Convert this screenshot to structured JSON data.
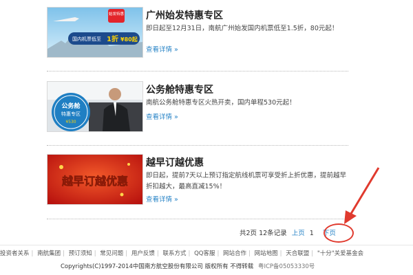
{
  "promos": [
    {
      "title": "广州始发特惠专区",
      "desc": "即日起至12月31日，南航广州始发国内机票低至1.5折，80元起！",
      "more": "查看详情 »",
      "banner": {
        "badge": "始发特惠",
        "line1": "国内机票低至",
        "price": "1折",
        "price2": "¥80起"
      }
    },
    {
      "title": "公务舱特惠专区",
      "desc": "南航公务舱特惠专区火热开卖，国内单程530元起！",
      "more": "查看详情 »",
      "banner": {
        "line1": "公务舱",
        "line2": "特惠专区",
        "price": "¥530"
      }
    },
    {
      "title": "越早订越优惠",
      "desc": "即日起，提前7天以上预订指定航线机票可享受折上折优惠，提前越早折扣越大，最高直减15%！",
      "more": "查看详情 »",
      "banner": {
        "text": "越早订越优惠"
      }
    }
  ],
  "pager": {
    "summary": "共2页 12条记录",
    "prev": "上页",
    "current": "1",
    "next": "下页"
  },
  "footer": {
    "links": [
      "投资者关系",
      "南航集团",
      "预订须知",
      "常见问题",
      "用户反馈",
      "联系方式",
      "QQ客服",
      "网站合作",
      "网站地图",
      "天合联盟",
      "\"十分\"关爱基金会"
    ],
    "copyright": "Copyrights(C)1997-2014中国南方航空股份有限公司 版权所有 不得转载",
    "icp": "粤ICP备05053330号"
  },
  "colors": {
    "link": "#2a85c7",
    "annotation": "#e03a2e"
  }
}
